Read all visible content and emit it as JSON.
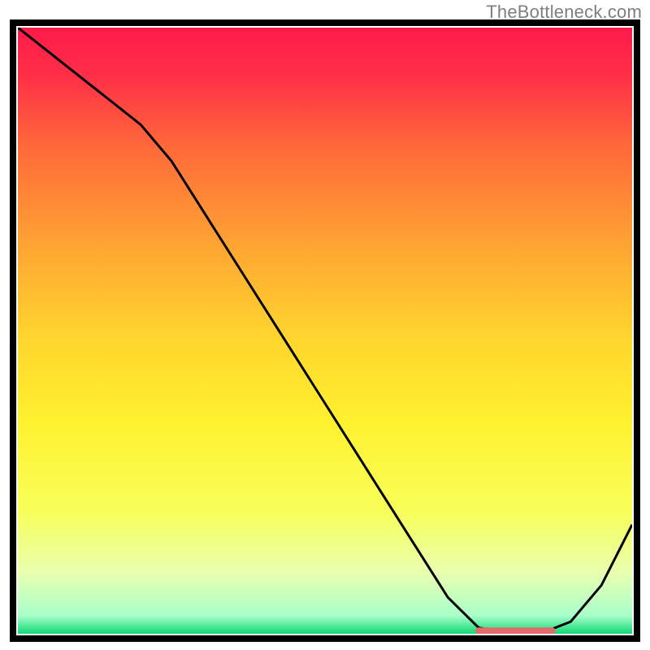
{
  "watermark": "TheBottleneck.com",
  "chart_data": {
    "type": "line",
    "title": "",
    "xlabel": "",
    "ylabel": "",
    "xlim": [
      0,
      100
    ],
    "ylim": [
      0,
      100
    ],
    "series": [
      {
        "name": "bottleneck-curve",
        "x": [
          0,
          5,
          10,
          15,
          20,
          25,
          30,
          35,
          40,
          45,
          50,
          55,
          60,
          65,
          70,
          75,
          80,
          85,
          90,
          95,
          100
        ],
        "y": [
          100,
          96,
          92,
          88,
          84,
          78,
          70,
          62,
          54,
          46,
          38,
          30,
          22,
          14,
          6,
          1,
          0,
          0,
          2,
          8,
          18
        ]
      }
    ],
    "highlight_band": {
      "x_start": 75,
      "x_end": 87,
      "y": 0.5,
      "color": "#e26a6a"
    },
    "gradient_stops": [
      {
        "offset": 0.0,
        "color": "#ff1a4a"
      },
      {
        "offset": 0.08,
        "color": "#ff2f47"
      },
      {
        "offset": 0.2,
        "color": "#ff6a3a"
      },
      {
        "offset": 0.35,
        "color": "#ffa133"
      },
      {
        "offset": 0.5,
        "color": "#ffd22e"
      },
      {
        "offset": 0.65,
        "color": "#fff12f"
      },
      {
        "offset": 0.8,
        "color": "#f8ff5a"
      },
      {
        "offset": 0.9,
        "color": "#e8ffb0"
      },
      {
        "offset": 0.97,
        "color": "#a9ffca"
      },
      {
        "offset": 1.0,
        "color": "#11d876"
      }
    ],
    "frame_color": "#000000",
    "frame_width": 8
  }
}
